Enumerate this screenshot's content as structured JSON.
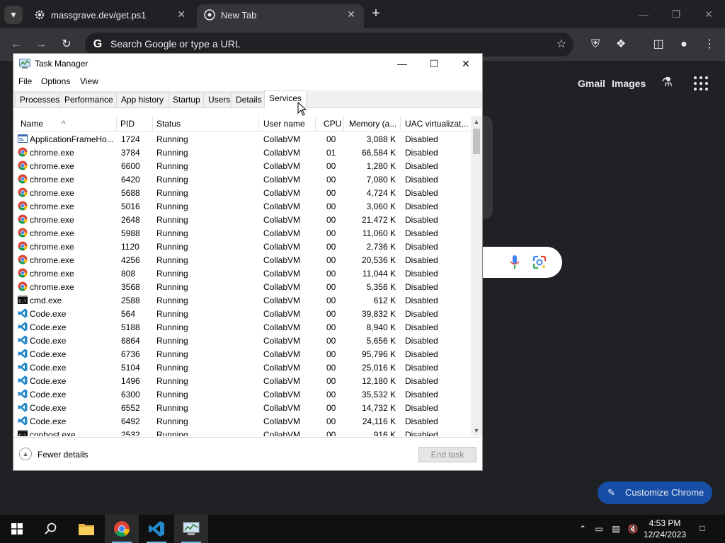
{
  "browser": {
    "tabs": [
      {
        "title": "massgrave.dev/get.ps1"
      },
      {
        "title": "New Tab"
      }
    ],
    "address_placeholder": "Search Google or type a URL",
    "ntp": {
      "gmail": "Gmail",
      "images": "Images",
      "customize": "Customize Chrome"
    }
  },
  "task_manager": {
    "title": "Task Manager",
    "menu": [
      "File",
      "Options",
      "View"
    ],
    "tabs": [
      "Processes",
      "Performance",
      "App history",
      "Startup",
      "Users",
      "Details",
      "Services"
    ],
    "active_tab": "Services",
    "columns": [
      "Name",
      "PID",
      "Status",
      "User name",
      "CPU",
      "Memory (a...",
      "UAC virtualizat..."
    ],
    "rows": [
      {
        "icon": "app-frame-icon",
        "name": "ApplicationFrameHo...",
        "pid": "1724",
        "status": "Running",
        "user": "CollabVM",
        "cpu": "00",
        "mem": "3,088 K",
        "uac": "Disabled"
      },
      {
        "icon": "chrome-icon",
        "name": "chrome.exe",
        "pid": "3784",
        "status": "Running",
        "user": "CollabVM",
        "cpu": "01",
        "mem": "66,584 K",
        "uac": "Disabled"
      },
      {
        "icon": "chrome-icon",
        "name": "chrome.exe",
        "pid": "6600",
        "status": "Running",
        "user": "CollabVM",
        "cpu": "00",
        "mem": "1,280 K",
        "uac": "Disabled"
      },
      {
        "icon": "chrome-icon",
        "name": "chrome.exe",
        "pid": "6420",
        "status": "Running",
        "user": "CollabVM",
        "cpu": "00",
        "mem": "7,080 K",
        "uac": "Disabled"
      },
      {
        "icon": "chrome-icon",
        "name": "chrome.exe",
        "pid": "5688",
        "status": "Running",
        "user": "CollabVM",
        "cpu": "00",
        "mem": "4,724 K",
        "uac": "Disabled"
      },
      {
        "icon": "chrome-icon",
        "name": "chrome.exe",
        "pid": "5016",
        "status": "Running",
        "user": "CollabVM",
        "cpu": "00",
        "mem": "3,060 K",
        "uac": "Disabled"
      },
      {
        "icon": "chrome-icon",
        "name": "chrome.exe",
        "pid": "2648",
        "status": "Running",
        "user": "CollabVM",
        "cpu": "00",
        "mem": "21,472 K",
        "uac": "Disabled"
      },
      {
        "icon": "chrome-icon",
        "name": "chrome.exe",
        "pid": "5988",
        "status": "Running",
        "user": "CollabVM",
        "cpu": "00",
        "mem": "11,060 K",
        "uac": "Disabled"
      },
      {
        "icon": "chrome-icon",
        "name": "chrome.exe",
        "pid": "1120",
        "status": "Running",
        "user": "CollabVM",
        "cpu": "00",
        "mem": "2,736 K",
        "uac": "Disabled"
      },
      {
        "icon": "chrome-icon",
        "name": "chrome.exe",
        "pid": "4256",
        "status": "Running",
        "user": "CollabVM",
        "cpu": "00",
        "mem": "20,536 K",
        "uac": "Disabled"
      },
      {
        "icon": "chrome-icon",
        "name": "chrome.exe",
        "pid": "808",
        "status": "Running",
        "user": "CollabVM",
        "cpu": "00",
        "mem": "11,044 K",
        "uac": "Disabled"
      },
      {
        "icon": "chrome-icon",
        "name": "chrome.exe",
        "pid": "3568",
        "status": "Running",
        "user": "CollabVM",
        "cpu": "00",
        "mem": "5,356 K",
        "uac": "Disabled"
      },
      {
        "icon": "cmd-icon",
        "name": "cmd.exe",
        "pid": "2588",
        "status": "Running",
        "user": "CollabVM",
        "cpu": "00",
        "mem": "612 K",
        "uac": "Disabled"
      },
      {
        "icon": "vscode-icon",
        "name": "Code.exe",
        "pid": "564",
        "status": "Running",
        "user": "CollabVM",
        "cpu": "00",
        "mem": "39,832 K",
        "uac": "Disabled"
      },
      {
        "icon": "vscode-icon",
        "name": "Code.exe",
        "pid": "5188",
        "status": "Running",
        "user": "CollabVM",
        "cpu": "00",
        "mem": "8,940 K",
        "uac": "Disabled"
      },
      {
        "icon": "vscode-icon",
        "name": "Code.exe",
        "pid": "6864",
        "status": "Running",
        "user": "CollabVM",
        "cpu": "00",
        "mem": "5,656 K",
        "uac": "Disabled"
      },
      {
        "icon": "vscode-icon",
        "name": "Code.exe",
        "pid": "6736",
        "status": "Running",
        "user": "CollabVM",
        "cpu": "00",
        "mem": "95,796 K",
        "uac": "Disabled"
      },
      {
        "icon": "vscode-icon",
        "name": "Code.exe",
        "pid": "5104",
        "status": "Running",
        "user": "CollabVM",
        "cpu": "00",
        "mem": "25,016 K",
        "uac": "Disabled"
      },
      {
        "icon": "vscode-icon",
        "name": "Code.exe",
        "pid": "1496",
        "status": "Running",
        "user": "CollabVM",
        "cpu": "00",
        "mem": "12,180 K",
        "uac": "Disabled"
      },
      {
        "icon": "vscode-icon",
        "name": "Code.exe",
        "pid": "6300",
        "status": "Running",
        "user": "CollabVM",
        "cpu": "00",
        "mem": "35,532 K",
        "uac": "Disabled"
      },
      {
        "icon": "vscode-icon",
        "name": "Code.exe",
        "pid": "6552",
        "status": "Running",
        "user": "CollabVM",
        "cpu": "00",
        "mem": "14,732 K",
        "uac": "Disabled"
      },
      {
        "icon": "vscode-icon",
        "name": "Code.exe",
        "pid": "6492",
        "status": "Running",
        "user": "CollabVM",
        "cpu": "00",
        "mem": "24,116 K",
        "uac": "Disabled"
      },
      {
        "icon": "cmd-icon",
        "name": "conhost.exe",
        "pid": "2532",
        "status": "Running",
        "user": "CollabVM",
        "cpu": "00",
        "mem": "916 K",
        "uac": "Disabled"
      }
    ],
    "footer": {
      "fewer_details": "Fewer details",
      "end_task": "End task"
    }
  },
  "taskbar": {
    "time": "4:53 PM",
    "date": "12/24/2023"
  },
  "colors": {
    "chrome_dark": "#202124",
    "accent_blue": "#174ea6",
    "taskbar": "#101010"
  }
}
